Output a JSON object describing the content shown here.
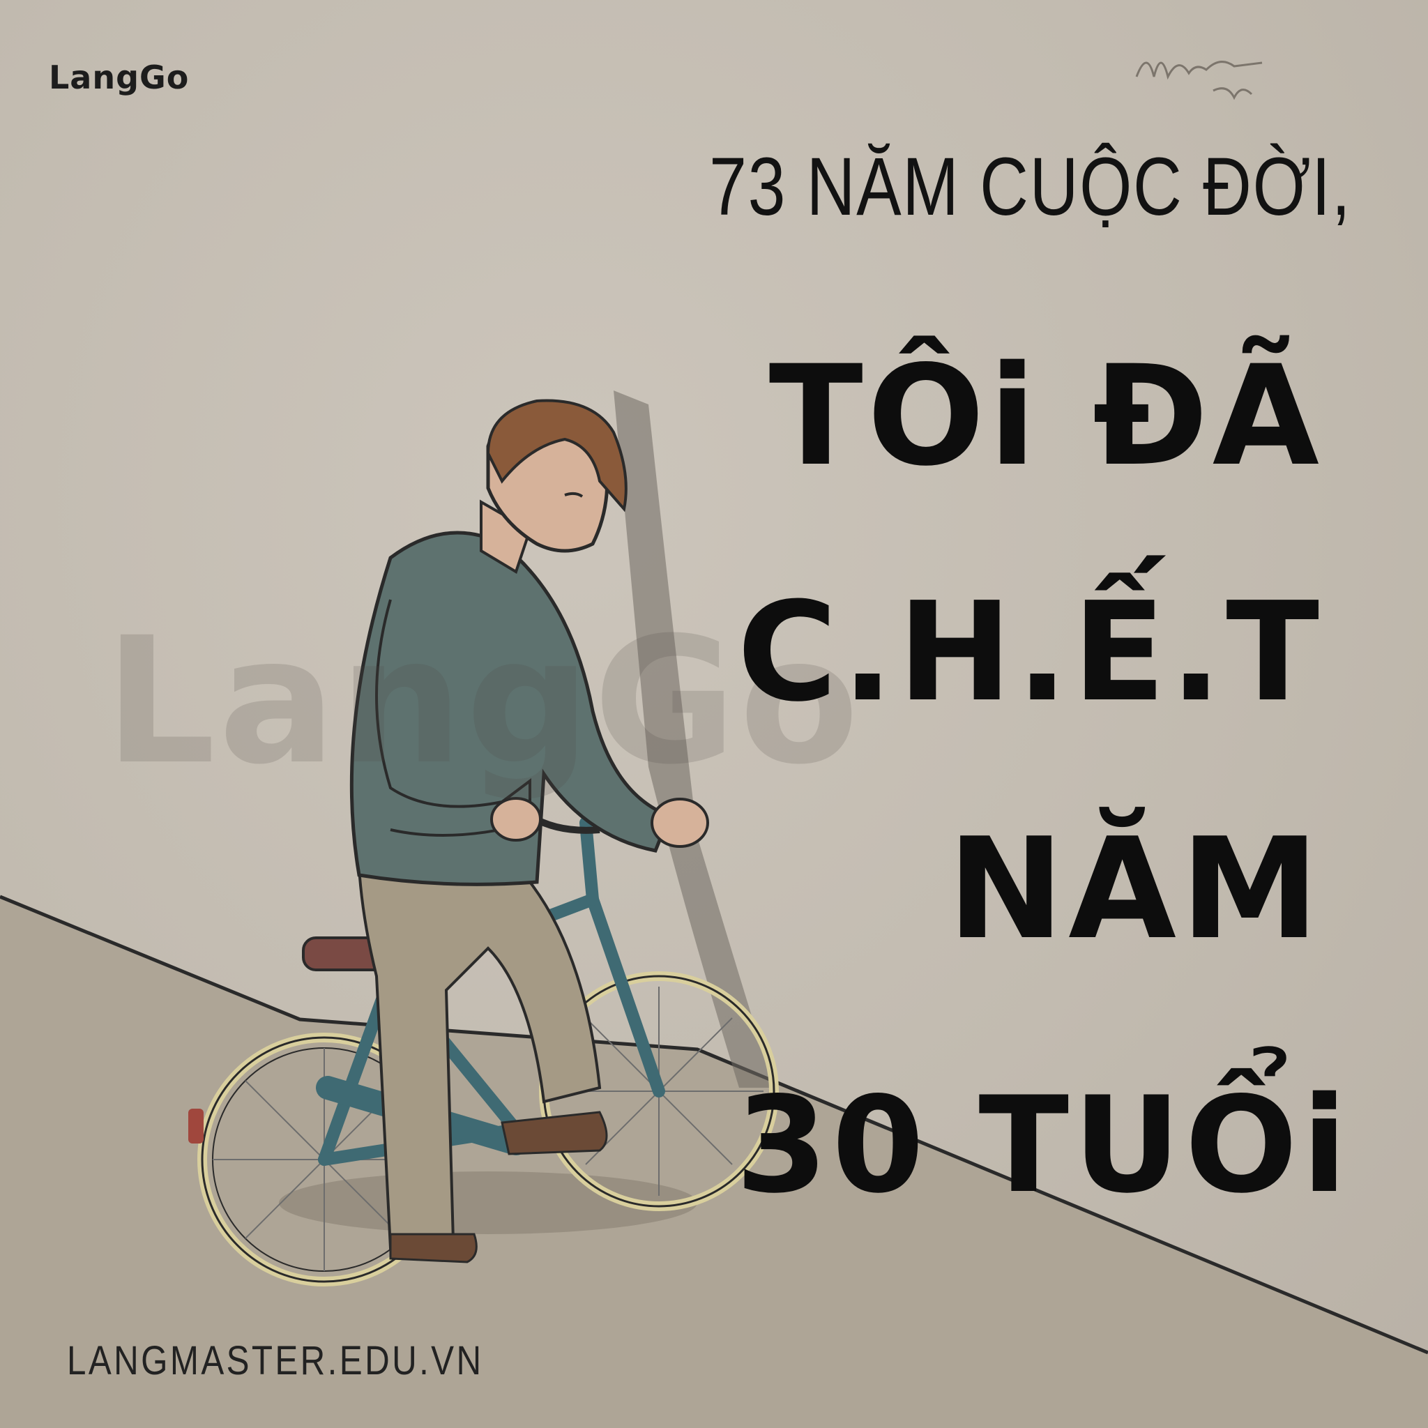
{
  "brand": {
    "logo_text": "LangGo",
    "watermark_text": "LangGo"
  },
  "headline": {
    "line": "73 NĂM CUỘC ĐỜI,"
  },
  "title": {
    "line1": "TÔi ĐÃ",
    "line2": "C.H.Ế.T",
    "line3": "NĂM",
    "line4": "30 TUỔi"
  },
  "footer": {
    "website": "LANGMASTER.EDU.VN"
  },
  "colors": {
    "background": "#c5beb3",
    "text": "#121212",
    "sweater": "#5e726f",
    "bicycle": "#3f6a73",
    "pants": "#a59a85",
    "seat": "#7a4a44",
    "hair": "#8a5a3a"
  }
}
